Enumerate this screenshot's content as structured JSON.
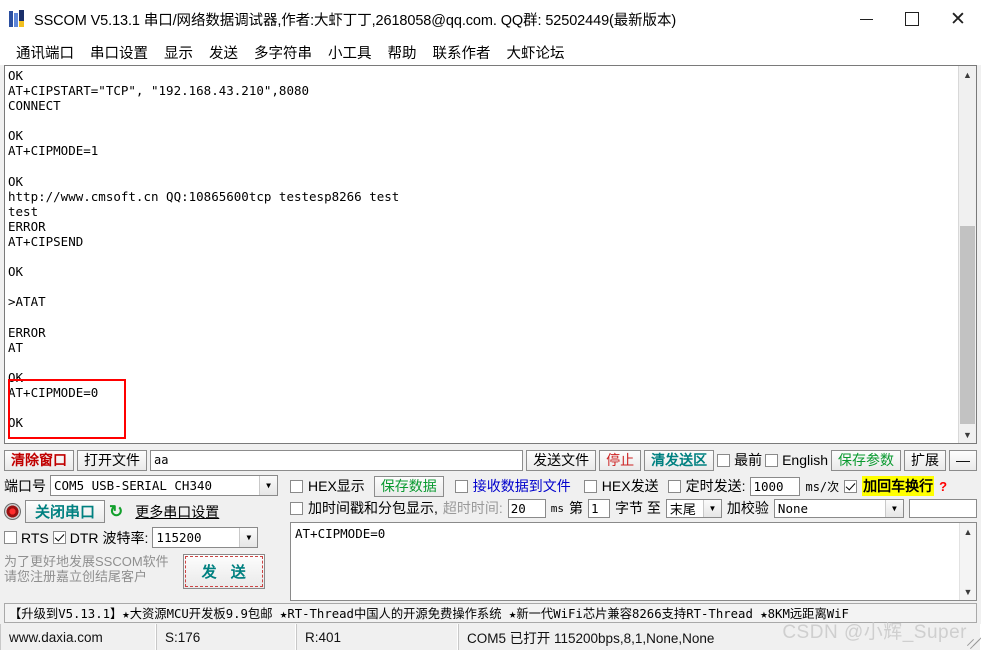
{
  "window": {
    "title": "SSCOM V5.13.1 串口/网络数据调试器,作者:大虾丁丁,2618058@qq.com. QQ群: 52502449(最新版本)",
    "minimize": "–",
    "maximize": "□",
    "close": "✕"
  },
  "menu": {
    "items": [
      {
        "label": "通讯端口"
      },
      {
        "label": "串口设置"
      },
      {
        "label": "显示"
      },
      {
        "label": "发送"
      },
      {
        "label": "多字符串"
      },
      {
        "label": "小工具"
      },
      {
        "label": "帮助"
      },
      {
        "label": "联系作者"
      },
      {
        "label": "大虾论坛"
      }
    ]
  },
  "receive": {
    "text": "OK\nAT+CIPSTART=\"TCP\", \"192.168.43.210\",8080\nCONNECT\n\nOK\nAT+CIPMODE=1\n\nOK\nhttp://www.cmsoft.cn QQ:10865600tcp testesp8266 test\ntest\nERROR\nAT+CIPSEND\n\nOK\n\n>ATAT\n\nERROR\nAT\n\nOK\nAT+CIPMODE=0\n\nOK",
    "scroll_up": "⌃",
    "scroll_down": "⌄",
    "highlight_color": "#ff0000"
  },
  "toolbar": {
    "clear_window": "清除窗口",
    "open_file": "打开文件",
    "file_path": "aa",
    "send_file": "发送文件",
    "stop": "停止",
    "clear_send": "清发送区",
    "topmost": {
      "label": "最前",
      "checked": false
    },
    "english": {
      "label": "English",
      "checked": false
    },
    "save_params": "保存参数",
    "extend": "扩展",
    "collapse": "—"
  },
  "serial": {
    "port_label": "端口号",
    "port_value": "COM5  USB-SERIAL CH340",
    "close_port_button": "关闭串口",
    "refresh_icon": "↻",
    "more_settings": "更多串口设置",
    "rts": {
      "label": "RTS",
      "checked": false
    },
    "dtr": {
      "label": "DTR",
      "checked": true
    },
    "baud_label": "波特率:",
    "baud_value": "115200",
    "register_note": "为了更好地发展SSCOM软件\n请您注册嘉立创结尾客户",
    "send_button": "发 送"
  },
  "recv_options": {
    "hex_display": {
      "label": "HEX显示",
      "checked": false
    },
    "save_data": "保存数据",
    "save_to_file": {
      "label": "接收数据到文件",
      "checked": false
    },
    "timestamp": {
      "label": "加时间戳和分包显示,",
      "checked": false
    },
    "timeout_label": "超时时间:",
    "timeout_value": "20",
    "timeout_unit": "ms"
  },
  "send_options": {
    "hex_send": {
      "label": "HEX发送",
      "checked": false
    },
    "timed_send": {
      "label": "定时发送:",
      "checked": false
    },
    "interval_value": "1000",
    "interval_unit": "ms/次",
    "add_crlf": {
      "label": "加回车换行",
      "checked": true
    },
    "help_mark": "?",
    "byte_from_label": "第",
    "byte_from_value": "1",
    "byte_mid_label": "字节 至",
    "byte_to_value": "末尾",
    "checksum_label": "加校验",
    "checksum_value": "None"
  },
  "send_area": {
    "text": "AT+CIPMODE=0"
  },
  "ad_banner": {
    "text": "【升级到V5.13.1】★大资源MCU开发板9.9包邮 ★RT-Thread中国人的开源免费操作系统 ★新一代WiFi芯片兼容8266支持RT-Thread ★8KM远距离WiF"
  },
  "status": {
    "site": "www.daxia.com",
    "sent": "S:176",
    "received": "R:401",
    "connection": "COM5 已打开  115200bps,8,1,None,None"
  },
  "watermark": "CSDN @小辉_Super"
}
